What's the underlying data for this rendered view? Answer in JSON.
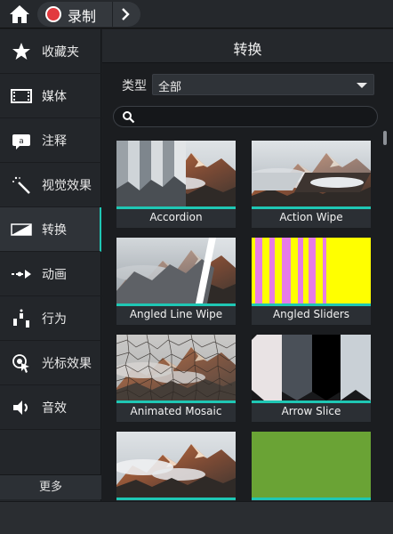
{
  "topbar": {
    "record_label": "录制"
  },
  "sidebar": {
    "items": [
      {
        "label": "收藏夹",
        "icon": "star-icon"
      },
      {
        "label": "媒体",
        "icon": "film-icon"
      },
      {
        "label": "注释",
        "icon": "annotation-icon"
      },
      {
        "label": "视觉效果",
        "icon": "magic-wand-icon"
      },
      {
        "label": "转换",
        "icon": "transition-icon",
        "active": true
      },
      {
        "label": "动画",
        "icon": "animation-arrow-icon"
      },
      {
        "label": "行为",
        "icon": "behavior-icon"
      },
      {
        "label": "光标效果",
        "icon": "cursor-effect-icon"
      },
      {
        "label": "音效",
        "icon": "speaker-icon"
      }
    ],
    "more_label": "更多"
  },
  "main": {
    "title": "转换",
    "type_label": "类型",
    "type_value": "全部",
    "search_placeholder": ""
  },
  "transitions": [
    {
      "label": "Accordion"
    },
    {
      "label": "Action Wipe"
    },
    {
      "label": "Angled Line Wipe"
    },
    {
      "label": "Angled Sliders"
    },
    {
      "label": "Animated Mosaic"
    },
    {
      "label": "Arrow Slice"
    },
    {
      "label": ""
    },
    {
      "label": ""
    }
  ],
  "colors": {
    "accent": "#1fc7b4",
    "record": "#e23a3f",
    "slider_yellow": "#ffff00",
    "slider_pink": "#e67ce6",
    "green_slide": "#6aa335"
  }
}
